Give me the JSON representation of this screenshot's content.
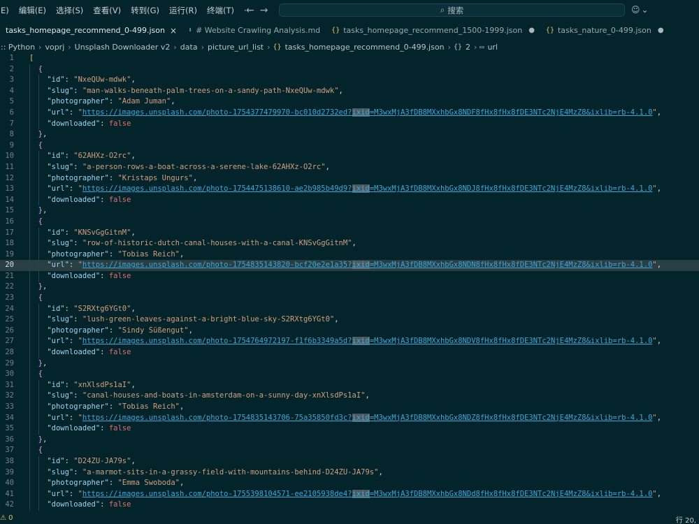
{
  "menu": [
    "E)",
    "编辑(E)",
    "选择(S)",
    "查看(V)",
    "转到(G)",
    "运行(R)",
    "终端(T)",
    "···"
  ],
  "search": {
    "label": "搜索"
  },
  "tabs": [
    {
      "label": "tasks_homepage_recommend_0-499.json",
      "icon": "",
      "active": true,
      "close": "×"
    },
    {
      "label": "# Website Crawling Analysis.md",
      "icon": "⬇",
      "active": false
    },
    {
      "label": "tasks_homepage_recommend_1500-1999.json",
      "icon": "{}",
      "active": false,
      "dot": "●"
    },
    {
      "label": "tasks_nature_0-499.json",
      "icon": "{}",
      "active": false,
      "dot": "●"
    }
  ],
  "breadcrumb": {
    "items": [
      ":: Python",
      "voprj",
      "Unsplash Downloader v2",
      "data",
      "picture_url_list",
      "tasks_homepage_recommend_0-499.json",
      "2",
      "url"
    ]
  },
  "editor": {
    "current_line": 20,
    "lines": [
      "[",
      "  {",
      "    \"id\": \"NxeQUw-mdwk\",",
      "    \"slug\": \"man-walks-beneath-palm-trees-on-a-sandy-path-NxeQUw-mdwk\",",
      "    \"photographer\": \"Adam Juman\",",
      "    \"url\": \"https://images.unsplash.com/photo-1754377479970-bc010d2732ed?ixid=M3wxMjA3fDB8MXxhbGx8NDF8fHx8fHx8fDE3NTc2NjE4MzZ8&ixlib=rb-4.1.0\",",
      "    \"downloaded\": false",
      "  },",
      "  {",
      "    \"id\": \"62AHXz-O2rc\",",
      "    \"slug\": \"a-person-rows-a-boat-across-a-serene-lake-62AHXz-O2rc\",",
      "    \"photographer\": \"Kristaps Ungurs\",",
      "    \"url\": \"https://images.unsplash.com/photo-1754475138610-ae2b985b49d9?ixid=M3wxMjA3fDB8MXxhbGx8NDJ8fHx8fHx8fDE3NTc2NjE4MzZ8&ixlib=rb-4.1.0\",",
      "    \"downloaded\": false",
      "  },",
      "  {",
      "    \"id\": \"KNSvGgGitnM\",",
      "    \"slug\": \"row-of-historic-dutch-canal-houses-with-a-canal-KNSvGgGitnM\",",
      "    \"photographer\": \"Tobias Reich\",",
      "    \"url\": \"https://images.unsplash.com/photo-1754835143820-bcf20e2e1a35?ixid=M3wxMjA3fDB8MXxhbGx8NDN8fHx8fHx8fDE3NTc2NjE4MzZ8&ixlib=rb-4.1.0\",",
      "    \"downloaded\": false",
      "  },",
      "  {",
      "    \"id\": \"S2RXtg6YGt0\",",
      "    \"slug\": \"lush-green-leaves-against-a-bright-blue-sky-S2RXtg6YGt0\",",
      "    \"photographer\": \"Sindy Süßengut\",",
      "    \"url\": \"https://images.unsplash.com/photo-1754764972197-f1f6b3349a5d?ixid=M3wxMjA3fDB8MXxhbGx8NDV8fHx8fHx8fDE3NTc2NjE4MzZ8&ixlib=rb-4.1.0\",",
      "    \"downloaded\": false",
      "  },",
      "  {",
      "    \"id\": \"xnXlsdPs1aI\",",
      "    \"slug\": \"canal-houses-and-boats-in-amsterdam-on-a-sunny-day-xnXlsdPs1aI\",",
      "    \"photographer\": \"Tobias Reich\",",
      "    \"url\": \"https://images.unsplash.com/photo-1754835143706-75a35850fd3c?ixid=M3wxMjA3fDB8MXxhbGx8NDZ8fHx8fHx8fDE3NTc2NjE4MzZ8&ixlib=rb-4.1.0\",",
      "    \"downloaded\": false",
      "  },",
      "  {",
      "    \"id\": \"D24ZU-JA79s\",",
      "    \"slug\": \"a-marmot-sits-in-a-grassy-field-with-mountains-behind-D24ZU-JA79s\",",
      "    \"photographer\": \"Emma Swoboda\",",
      "    \"url\": \"https://images.unsplash.com/photo-1755398104571-ee2105938de4?ixid=M3wxMjA3fDB8MXxhbGx8NDd8fHx8fHx8fDE3NTc2NjE4MzZ8&ixlib=rb-4.1.0\",",
      "    \"downloaded\": false"
    ]
  },
  "status": {
    "left": "⚠ 0",
    "right": "行 20,"
  },
  "colors": {
    "background": "#04242c",
    "key": "#9fd4f2",
    "string": "#d0a07e",
    "url": "#3ea6d8",
    "keyword": "#e0706a"
  }
}
